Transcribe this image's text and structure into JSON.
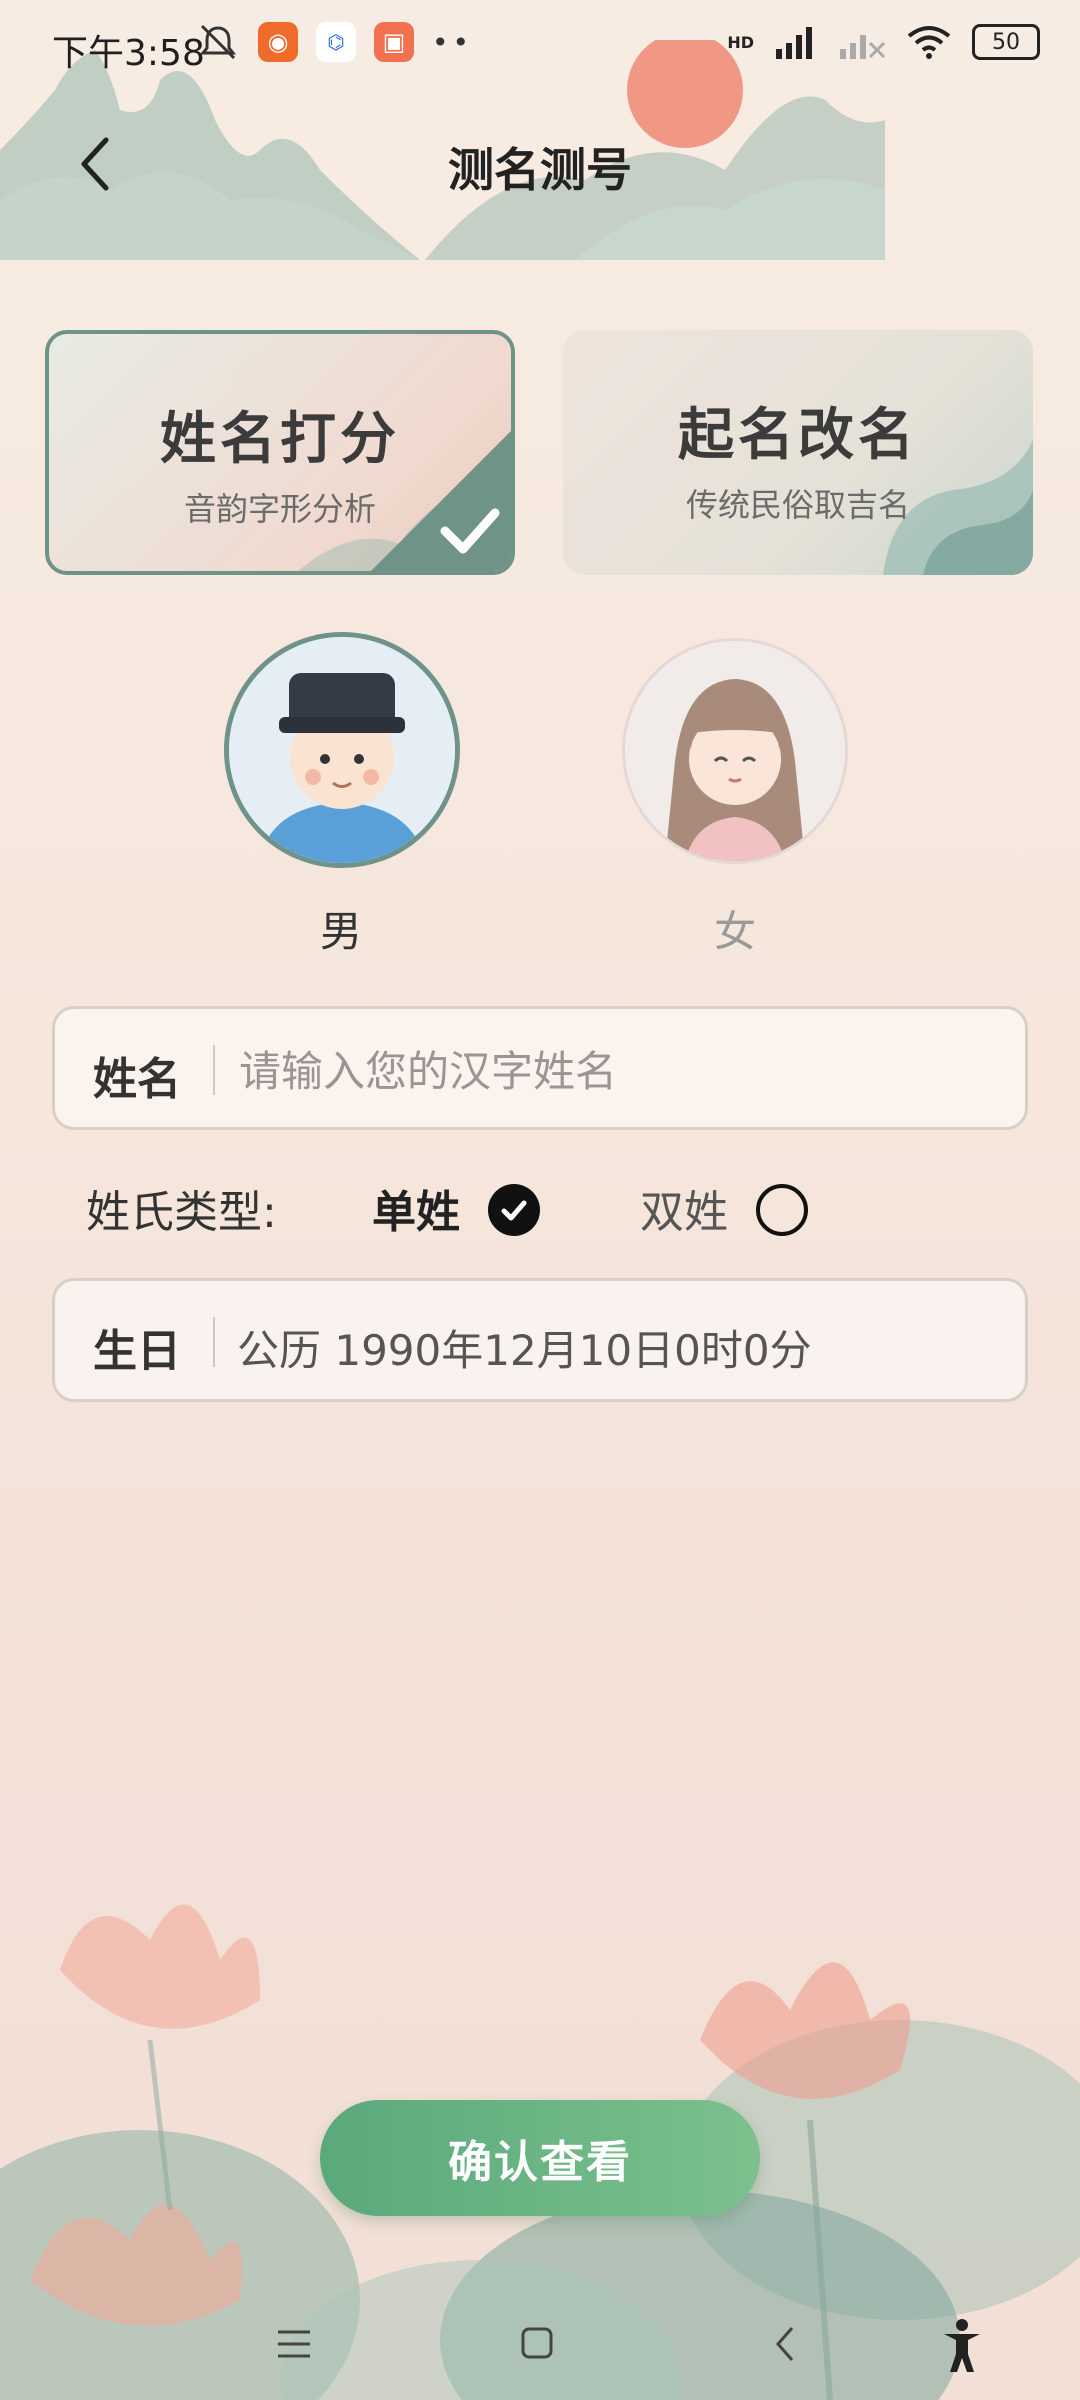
{
  "status": {
    "time": "下午3:58",
    "battery": "50",
    "network": "HD"
  },
  "header": {
    "title": "测名测号"
  },
  "cards": [
    {
      "title": "姓名打分",
      "subtitle": "音韵字形分析",
      "selected": true
    },
    {
      "title": "起名改名",
      "subtitle": "传统民俗取吉名",
      "selected": false
    }
  ],
  "gender": {
    "male_label": "男",
    "female_label": "女",
    "selected": "male"
  },
  "name_field": {
    "label": "姓名",
    "placeholder": "请输入您的汉字姓名",
    "value": ""
  },
  "surname_type": {
    "label": "姓氏类型:",
    "single": "单姓",
    "double": "双姓",
    "selected": "single"
  },
  "birthday_field": {
    "label": "生日",
    "value": "公历 1990年12月10日0时0分"
  },
  "confirm_label": "确认查看",
  "colors": {
    "accent": "#6f9289",
    "button_start": "#5aa97b",
    "button_end": "#7cc08d"
  }
}
